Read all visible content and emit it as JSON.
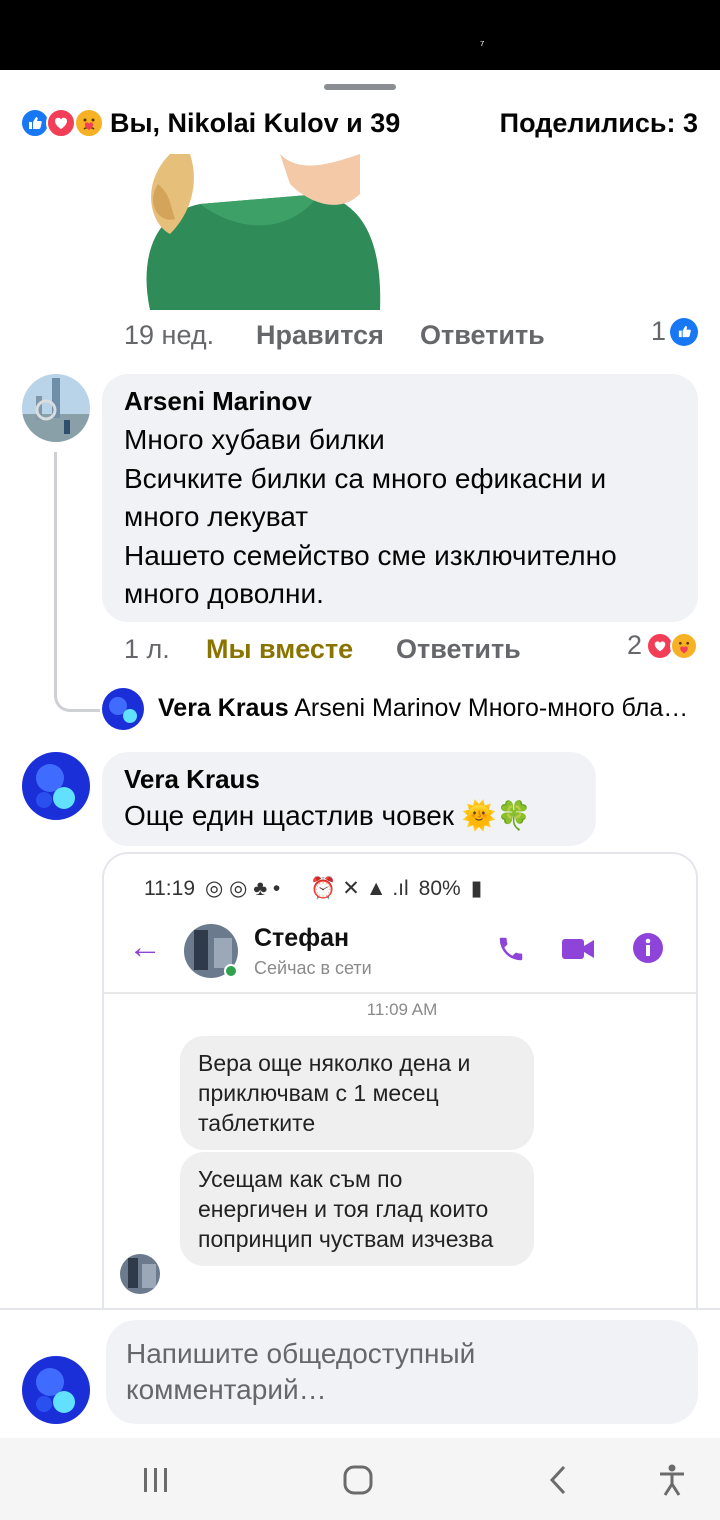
{
  "post": {
    "reactors_text": "Вы, Nikolai Kulov и 39",
    "shares_text": "Поделились: 3"
  },
  "comments": [
    {
      "time": "19 нед.",
      "like_label": "Нравится",
      "reply_label": "Ответить",
      "reaction_count": "1"
    },
    {
      "author": "Arseni Marinov",
      "text": "Много хубави билки\nВсичките билки са много ефикасни и много лекуват\nНашето семейство сме изключително много доволни.",
      "time": "1 л.",
      "like_label": "Мы вместе",
      "reply_label": "Ответить",
      "reaction_count": "2",
      "reply_preview": {
        "author": "Vera Kraus",
        "text": "Arseni Marinov Много-много бла…"
      }
    },
    {
      "author": "Vera Kraus",
      "text": "Още един щастлив човек 🌞🍀",
      "attachment": {
        "status_time": "11:19",
        "battery": "80%",
        "contact_name": "Стефан",
        "presence": "Сейчас в сети",
        "timestamp": "11:09 AM",
        "messages": [
          "Вера още няколко дена и приключвам с 1 месец таблетките",
          "Усещам как съм по енергичен и тоя глад които попринцип чуствам изчезва"
        ]
      }
    }
  ],
  "composer": {
    "placeholder": "Напишите общедоступный комментарий…"
  },
  "colors": {
    "accent": "#1877f2",
    "love": "#f33e58",
    "mixed_reaction_label": "#8a7400",
    "messenger_purple": "#8e44d8"
  }
}
